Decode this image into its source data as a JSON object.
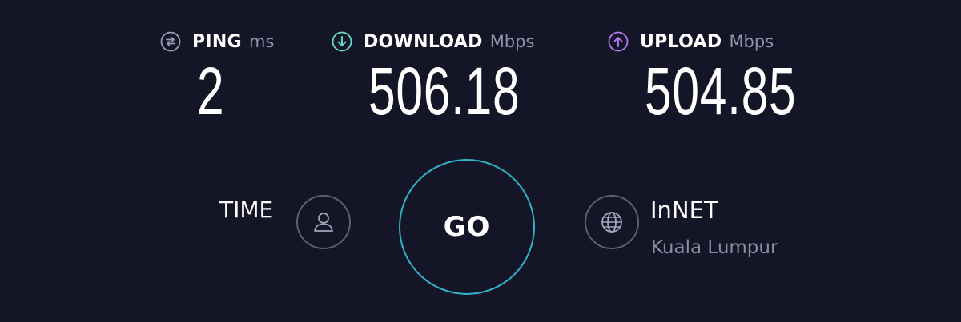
{
  "metrics": {
    "ping": {
      "label": "PING",
      "unit": "ms",
      "value": "2",
      "icon": "ping-icon",
      "color": "#9a9caf"
    },
    "download": {
      "label": "DOWNLOAD",
      "unit": "Mbps",
      "value": "506.18",
      "icon": "download-icon",
      "color": "#5fe0c8"
    },
    "upload": {
      "label": "UPLOAD",
      "unit": "Mbps",
      "value": "504.85",
      "icon": "upload-icon",
      "color": "#b57bee"
    }
  },
  "go_button": {
    "label": "GO",
    "ring_color": "#2fb4c9"
  },
  "profile": {
    "label": "TIME",
    "icon": "user-icon"
  },
  "server": {
    "name": "InNET",
    "location": "Kuala Lumpur",
    "icon": "globe-icon"
  },
  "colors": {
    "background": "#141526",
    "muted_text": "#8a8c9f"
  }
}
